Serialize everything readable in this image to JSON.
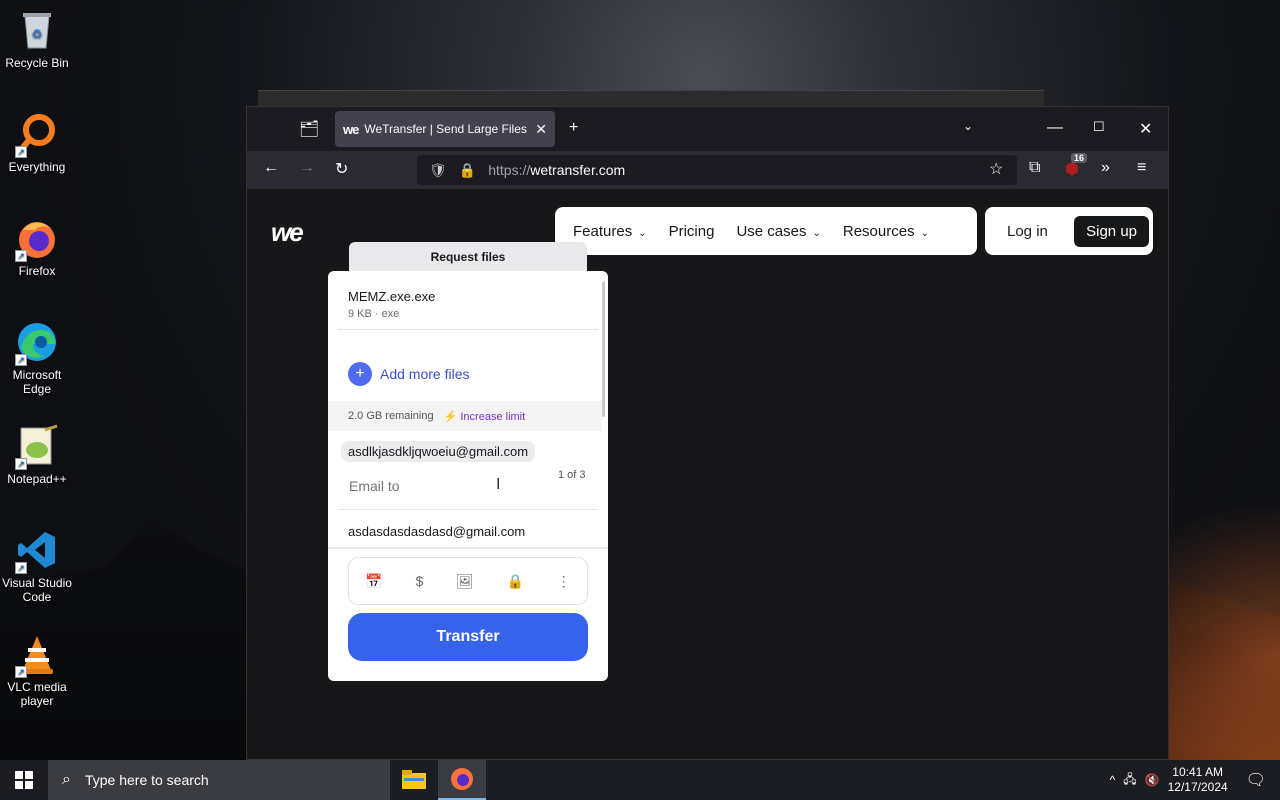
{
  "desktop": {
    "icons": [
      {
        "label": "Recycle Bin",
        "icon": "recycle-bin-icon"
      },
      {
        "label": "Everything",
        "icon": "everything-search-icon"
      },
      {
        "label": "Firefox",
        "icon": "firefox-icon"
      },
      {
        "label": "Microsoft Edge",
        "icon": "edge-icon"
      },
      {
        "label": "Notepad++",
        "icon": "notepadpp-icon"
      },
      {
        "label": "Visual Studio Code",
        "icon": "vscode-icon"
      },
      {
        "label": "VLC media player",
        "icon": "vlc-icon"
      }
    ]
  },
  "browser": {
    "tab_title": "WeTransfer | Send Large Files Fa",
    "url_protocol": "https://",
    "url_host": "wetransfer.com",
    "extension_badge": "16"
  },
  "site": {
    "logo": "we",
    "nav": {
      "features": "Features",
      "pricing": "Pricing",
      "use_cases": "Use cases",
      "resources": "Resources",
      "login": "Log in",
      "signup": "Sign up"
    },
    "request_files_tab": "Request files",
    "panel": {
      "file_name": "MEMZ.exe.exe",
      "file_size": "9 KB",
      "file_type": "exe",
      "add_more": "Add more files",
      "remaining": "2.0 GB remaining",
      "increase": "Increase limit",
      "recipient_chip": "asdlkjasdkljqwoeiu@gmail.com",
      "recipient_count": "1 of 3",
      "email_to_placeholder": "Email to",
      "your_email": "asdasdasdasdasd@gmail.com",
      "transfer_button": "Transfer"
    }
  },
  "taskbar": {
    "search_placeholder": "Type here to search",
    "time": "10:41 AM",
    "date": "12/17/2024"
  }
}
